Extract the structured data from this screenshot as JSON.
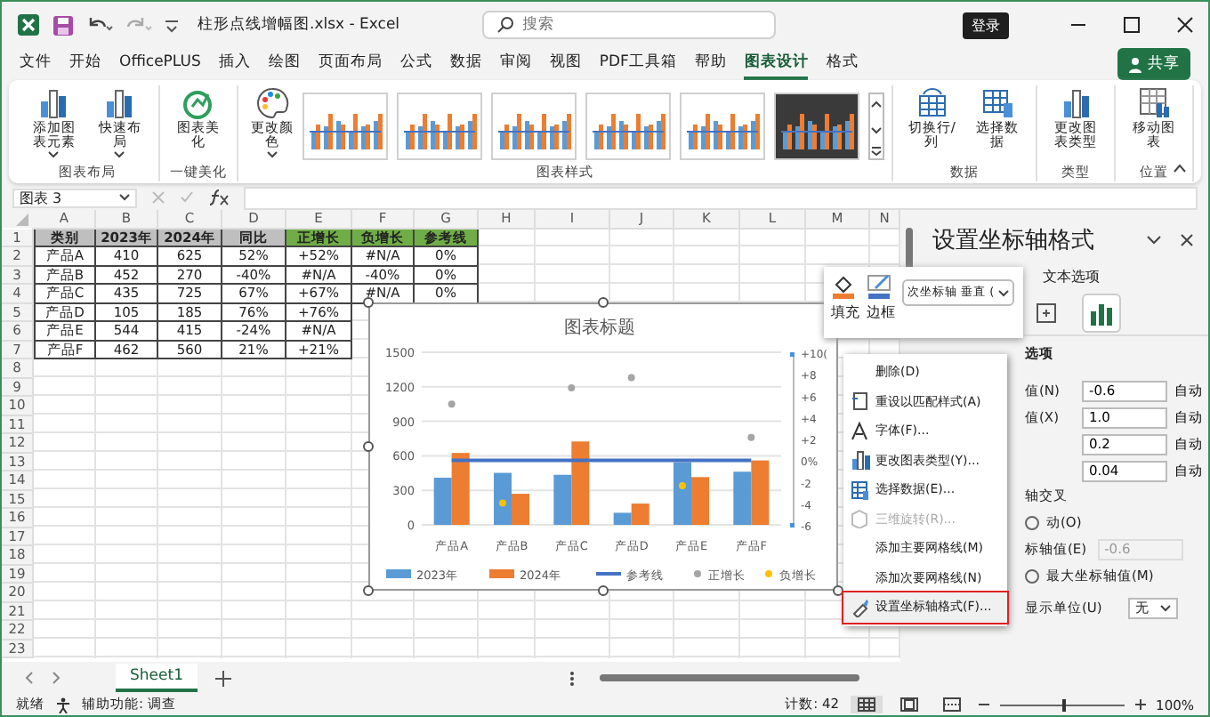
{
  "title_bar": {
    "filename": "柱形点线增幅图.xlsx - Excel",
    "search_placeholder": "搜索",
    "login": "登录"
  },
  "ribbon_tabs": [
    {
      "label": "文件",
      "selected": false
    },
    {
      "label": "开始",
      "selected": false
    },
    {
      "label": "OfficePLUS",
      "selected": false
    },
    {
      "label": "插入",
      "selected": false
    },
    {
      "label": "绘图",
      "selected": false
    },
    {
      "label": "页面布局",
      "selected": false
    },
    {
      "label": "公式",
      "selected": false
    },
    {
      "label": "数据",
      "selected": false
    },
    {
      "label": "审阅",
      "selected": false
    },
    {
      "label": "视图",
      "selected": false
    },
    {
      "label": "PDF工具箱",
      "selected": false
    },
    {
      "label": "帮助",
      "selected": false
    },
    {
      "label": "图表设计",
      "selected": true
    },
    {
      "label": "格式",
      "selected": false
    }
  ],
  "share": "共享",
  "ribbon_groups": [
    {
      "title": "图表布局",
      "buttons": [
        {
          "label": "添加图表元素",
          "dropdown": true
        },
        {
          "label": "快速布局",
          "dropdown": true
        }
      ]
    },
    {
      "title": "一键美化",
      "buttons": [
        {
          "label": "图表美化",
          "dropdown": false
        }
      ]
    },
    {
      "title": "图表样式",
      "buttons": [
        {
          "label": "更改颜色",
          "dropdown": true
        }
      ],
      "gallery": [
        {
          "kind": "light"
        },
        {
          "kind": "light"
        },
        {
          "kind": "light"
        },
        {
          "kind": "light"
        },
        {
          "kind": "light"
        },
        {
          "kind": "dark"
        }
      ]
    },
    {
      "title": "数据",
      "buttons": [
        {
          "label": "切换行/列",
          "dropdown": false
        },
        {
          "label": "选择数据",
          "dropdown": false
        }
      ]
    },
    {
      "title": "类型",
      "buttons": [
        {
          "label": "更改图表类型",
          "dropdown": false
        }
      ]
    },
    {
      "title": "位置",
      "buttons": [
        {
          "label": "移动图表",
          "dropdown": false
        }
      ]
    }
  ],
  "formula_bar": {
    "name_box": "图表 3"
  },
  "sheet": {
    "columns": [
      "A",
      "B",
      "C",
      "D",
      "E",
      "F",
      "G",
      "H",
      "I",
      "J",
      "K",
      "L",
      "M",
      "N"
    ],
    "row_numbers": [
      "1",
      "2",
      "3",
      "4",
      "5",
      "6",
      "7",
      "8",
      "9",
      "10",
      "11",
      "12",
      "13",
      "14",
      "15",
      "16",
      "17",
      "18",
      "19",
      "20",
      "21",
      "22",
      "23"
    ],
    "header_cells": [
      {
        "text": "类别",
        "color": "#bfbfbf"
      },
      {
        "text": "2023年",
        "color": "#bfbfbf"
      },
      {
        "text": "2024年",
        "color": "#bfbfbf"
      },
      {
        "text": "同比",
        "color": "#bfbfbf"
      },
      {
        "text": "正增长",
        "color": "#70ad47"
      },
      {
        "text": "负增长",
        "color": "#70ad47"
      },
      {
        "text": "参考线",
        "color": "#70ad47"
      }
    ],
    "rows": [
      [
        "产品A",
        "410",
        "625",
        "52%",
        "+52%",
        "#N/A",
        "0%"
      ],
      [
        "产品B",
        "452",
        "270",
        "-40%",
        "#N/A",
        "-40%",
        "0%"
      ],
      [
        "产品C",
        "435",
        "725",
        "67%",
        "+67%",
        "#N/A",
        "0%"
      ],
      [
        "产品D",
        "105",
        "185",
        "76%",
        "+76%"
      ],
      [
        "产品E",
        "544",
        "415",
        "-24%",
        "#N/A"
      ],
      [
        "产品F",
        "462",
        "560",
        "21%",
        "+21%"
      ]
    ]
  },
  "chart": {
    "chart_data": {
      "type": "bar",
      "title": "图表标题",
      "categories": [
        "产品A",
        "产品B",
        "产品C",
        "产品D",
        "产品E",
        "产品F"
      ],
      "ylim": [
        0,
        1500
      ],
      "yticks": [
        0,
        300,
        600,
        900,
        1200,
        1500
      ],
      "grid": true,
      "legend": "bottom",
      "series": [
        {
          "name": "2023年",
          "color": "#5b9bd5",
          "values": [
            410,
            452,
            435,
            105,
            544,
            462
          ]
        },
        {
          "name": "2024年",
          "color": "#ed7d31",
          "values": [
            625,
            270,
            725,
            185,
            415,
            560
          ]
        },
        {
          "name": "参考线",
          "color": "#4472c4",
          "type": "line",
          "values": [
            560,
            560,
            560,
            560,
            560,
            560
          ]
        },
        {
          "name": "正增长",
          "color": "#a5a5a5",
          "type": "scatter",
          "values": [
            1050,
            null,
            1190,
            1280,
            null,
            760
          ]
        },
        {
          "name": "负增长",
          "color": "#ffc000",
          "type": "scatter",
          "values": [
            null,
            190,
            null,
            null,
            340,
            null
          ]
        }
      ]
    },
    "secondary_axis_labels": [
      "+10(",
      "+8",
      "+6",
      "+4",
      "+2",
      "0%",
      "-2",
      "-4",
      "-6"
    ]
  },
  "mini_toolbar": {
    "fill": "填充",
    "border": "边框",
    "element": "次坐标轴 垂直 ("
  },
  "context_menu": [
    {
      "label": "删除(D)",
      "disabled": false,
      "highlighted": false
    },
    {
      "label": "重设以匹配样式(A)",
      "disabled": false,
      "highlighted": false
    },
    {
      "label": "字体(F)...",
      "disabled": false,
      "highlighted": false
    },
    {
      "label": "更改图表类型(Y)...",
      "disabled": false,
      "highlighted": false
    },
    {
      "label": "选择数据(E)...",
      "disabled": false,
      "highlighted": false
    },
    {
      "label": "三维旋转(R)...",
      "disabled": true,
      "highlighted": false
    },
    {
      "label": "添加主要网格线(M)",
      "disabled": false,
      "highlighted": false
    },
    {
      "label": "添加次要网格线(N)",
      "disabled": false,
      "highlighted": false
    },
    {
      "label": "设置坐标轴格式(F)...",
      "disabled": false,
      "highlighted": true
    }
  ],
  "format_pane": {
    "title": "设置坐标轴格式",
    "tab": "文本选项",
    "icon_tabs": [
      {
        "selected": false
      },
      {
        "selected": true
      }
    ],
    "section": "选项",
    "fields": [
      {
        "label": "值(N)",
        "value": "-0.6",
        "action": "自动"
      },
      {
        "label": "值(X)",
        "value": "1.0",
        "action": "自动"
      },
      {
        "value": "0.2",
        "action": "自动"
      },
      {
        "value": "0.04",
        "action": "自动"
      }
    ],
    "cross_label": "轴交叉",
    "radio_auto": {
      "label": "动(O)",
      "selected": false
    },
    "axis_value": {
      "label": "标轴值(E)",
      "value": "-0.6",
      "disabled": true
    },
    "radio_max": {
      "label": "最大坐标轴值(M)",
      "selected": false
    },
    "display_units": {
      "label": "显示单位(U)",
      "value": "无"
    }
  },
  "sheet_tabs": [
    {
      "label": "Sheet1",
      "selected": true
    }
  ],
  "status_bar": {
    "ready": "就绪",
    "accessibility": "辅助功能: 调查",
    "count": "计数: 42",
    "views": [
      {
        "selected": true
      },
      {
        "selected": false
      },
      {
        "selected": false
      }
    ],
    "zoom": {
      "level": 0.5,
      "reading": "100%"
    }
  }
}
